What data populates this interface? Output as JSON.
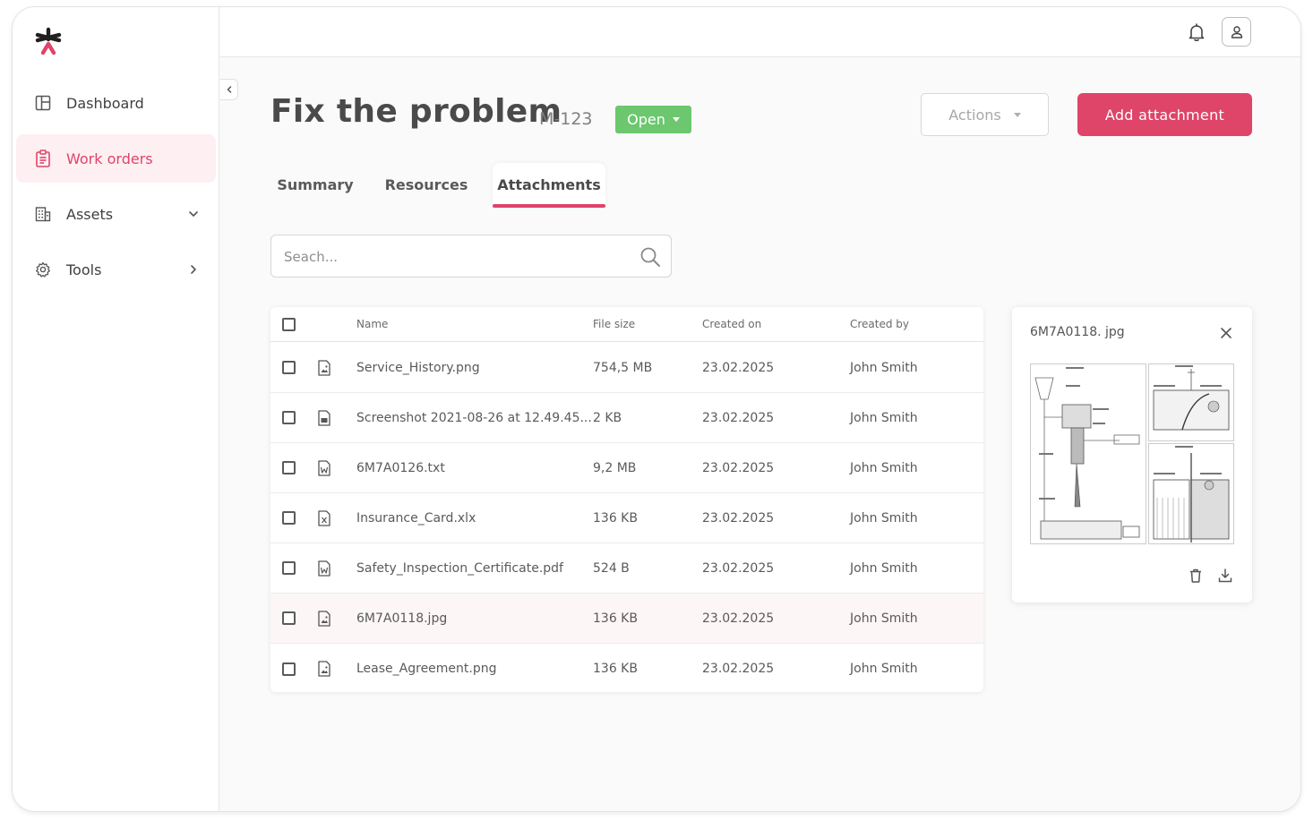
{
  "sidebar": {
    "items": [
      {
        "label": "Dashboard",
        "icon": "dashboard-icon"
      },
      {
        "label": "Work orders",
        "icon": "clipboard-icon",
        "active": true
      },
      {
        "label": "Assets",
        "icon": "building-icon",
        "chevron": "chevron-down-icon"
      },
      {
        "label": "Tools",
        "icon": "gear-icon",
        "chevron": "chevron-right-icon"
      }
    ]
  },
  "header": {
    "title": "Fix the problem",
    "code": "M-123",
    "status": "Open",
    "actions_label": "Actions",
    "add_label": "Add attachment"
  },
  "tabs": [
    {
      "label": "Summary"
    },
    {
      "label": "Resources"
    },
    {
      "label": "Attachments",
      "active": true
    }
  ],
  "search": {
    "placeholder": "Seach...",
    "value": ""
  },
  "table": {
    "columns": [
      "Name",
      "File size",
      "Created on",
      "Created by"
    ],
    "rows": [
      {
        "icon": "image-file-icon",
        "name": "Service_History.png",
        "size": "754,5 MB",
        "created_on": "23.02.2025",
        "created_by": "John Smith"
      },
      {
        "icon": "document-file-icon",
        "name": "Screenshot 2021-08-26 at 12.49.45...",
        "size": "2 KB",
        "created_on": "23.02.2025",
        "created_by": "John Smith"
      },
      {
        "icon": "word-file-icon",
        "name": "6M7A0126.txt",
        "size": "9,2 MB",
        "created_on": "23.02.2025",
        "created_by": "John Smith"
      },
      {
        "icon": "excel-file-icon",
        "name": "Insurance_Card.xlx",
        "size": "136 KB",
        "created_on": "23.02.2025",
        "created_by": "John Smith"
      },
      {
        "icon": "word-file-icon",
        "name": "Safety_Inspection_Certificate.pdf",
        "size": "524 B",
        "created_on": "23.02.2025",
        "created_by": "John Smith"
      },
      {
        "icon": "image-file-icon",
        "name": "6M7A0118.jpg",
        "size": "136 KB",
        "created_on": "23.02.2025",
        "created_by": "John Smith",
        "highlighted": true
      },
      {
        "icon": "image-file-icon",
        "name": "Lease_Agreement.png",
        "size": "136 KB",
        "created_on": "23.02.2025",
        "created_by": "John Smith"
      }
    ]
  },
  "preview": {
    "title": "6M7A0118. jpg"
  },
  "colors": {
    "accent": "#df4469",
    "status_open": "#6cc76e",
    "active_bg": "#fdeff2"
  }
}
